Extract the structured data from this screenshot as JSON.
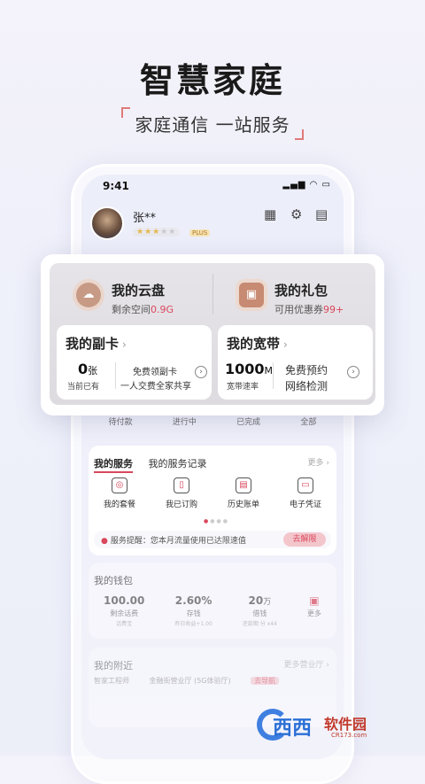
{
  "hero": {
    "title": "智慧家庭",
    "subtitle": "家庭通信 一站服务"
  },
  "status": {
    "time": "9:41",
    "icons": "▂▄▆ ◠ ▭"
  },
  "user": {
    "name": "张**",
    "stars_on": "★★★",
    "stars_off": "★★",
    "plus_badge": "PLUS"
  },
  "top_icons": {
    "sign": "▦",
    "settings": "⚙",
    "message": "▤"
  },
  "popup": {
    "cloud": {
      "title": "我的云盘",
      "sub_label": "剩余空间",
      "sub_value": "0.9G"
    },
    "gift": {
      "title": "我的礼包",
      "sub_label": "可用优惠券",
      "sub_value": "99+"
    },
    "vice": {
      "title": "我的副卡",
      "chev": "›",
      "num": "0",
      "unit": "张",
      "num_label": "当前已有",
      "desc1": "免费领副卡",
      "desc2": "一人交费全家共享"
    },
    "bb": {
      "title": "我的宽带",
      "chev": "›",
      "num": "1000",
      "unit": "M",
      "num_label": "宽带速率",
      "desc1": "免费预约",
      "desc2": "网络检测"
    }
  },
  "orders": [
    "待付款",
    "进行中",
    "已完成",
    "全部"
  ],
  "services": {
    "tab_active": "我的服务",
    "tab_other": "我的服务记录",
    "more": "更多 ›",
    "items": [
      "我的套餐",
      "我已订购",
      "历史账单",
      "电子凭证"
    ],
    "notice": "服务提醒：您本月流量使用已达限速值",
    "notice_btn": "去解限"
  },
  "wallet": {
    "title": "我的钱包",
    "stats": [
      {
        "value": "100.00",
        "unit": "",
        "label": "剩余话费",
        "sub": "话费宝"
      },
      {
        "value": "2.60%",
        "unit": "",
        "label": "存钱",
        "sub": "昨日收益+1.00"
      },
      {
        "value": "20",
        "unit": "万",
        "label": "借钱",
        "sub": "还款期 分 x44"
      }
    ],
    "more": "更多"
  },
  "nearby": {
    "title": "我的附近",
    "more": "更多营业厅 ›",
    "row": [
      "智家工程师",
      "金融街营业厅 (5G体验厅)"
    ],
    "tag": "去导航"
  },
  "watermark": {
    "a": "西西",
    "b": "软件园",
    "url": "CR173.com"
  },
  "colors": {
    "accent": "#d9475c"
  }
}
